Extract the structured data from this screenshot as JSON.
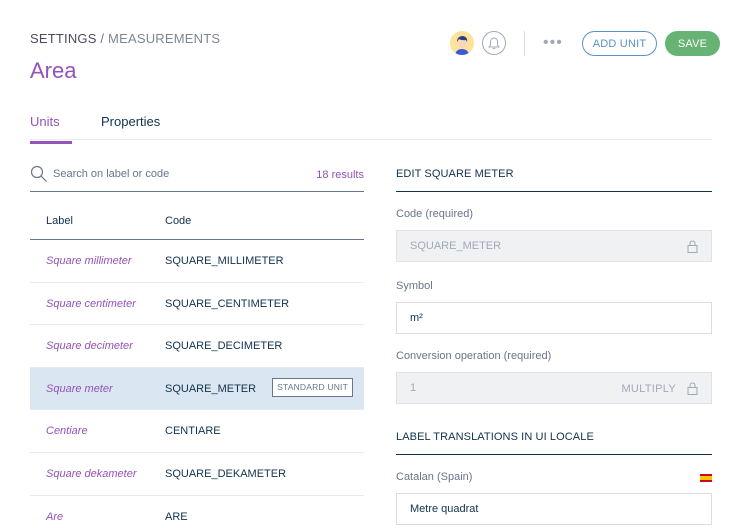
{
  "header": {
    "breadcrumb_root": "SETTINGS",
    "breadcrumb_sep": "/",
    "breadcrumb_current": "MEASUREMENTS",
    "title": "Area",
    "add_unit_label": "ADD UNIT",
    "save_label": "SAVE",
    "more_label": "•••"
  },
  "tabs": [
    {
      "label": "Units",
      "active": true
    },
    {
      "label": "Properties",
      "active": false
    }
  ],
  "search": {
    "placeholder": "Search on label or code",
    "results": "18 results"
  },
  "table": {
    "headers": [
      "Label",
      "Code"
    ],
    "rows": [
      {
        "label": "Square millimeter",
        "code": "SQUARE_MILLIMETER"
      },
      {
        "label": "Square centimeter",
        "code": "SQUARE_CENTIMETER"
      },
      {
        "label": "Square decimeter",
        "code": "SQUARE_DECIMETER"
      },
      {
        "label": "Square meter",
        "code": "SQUARE_METER",
        "badge": "STANDARD UNIT",
        "selected": true
      },
      {
        "label": "Centiare",
        "code": "CENTIARE"
      },
      {
        "label": "Square dekameter",
        "code": "SQUARE_DEKAMETER"
      },
      {
        "label": "Are",
        "code": "ARE"
      }
    ]
  },
  "edit": {
    "title": "EDIT SQUARE METER",
    "code_label": "Code (required)",
    "code_value": "SQUARE_METER",
    "symbol_label": "Symbol",
    "symbol_value": "m²",
    "conversion_label": "Conversion operation (required)",
    "conversion_value": "1",
    "conversion_operator": "MULTIPLY",
    "translations_title": "LABEL TRANSLATIONS IN UI LOCALE",
    "locale_label": "Catalan (Spain)",
    "locale_value": "Metre quadrat"
  },
  "colors": {
    "accent": "#9452ba",
    "primary_blue": "#5992c7",
    "save_green": "#67b373",
    "selected_row": "#dae7f2"
  }
}
